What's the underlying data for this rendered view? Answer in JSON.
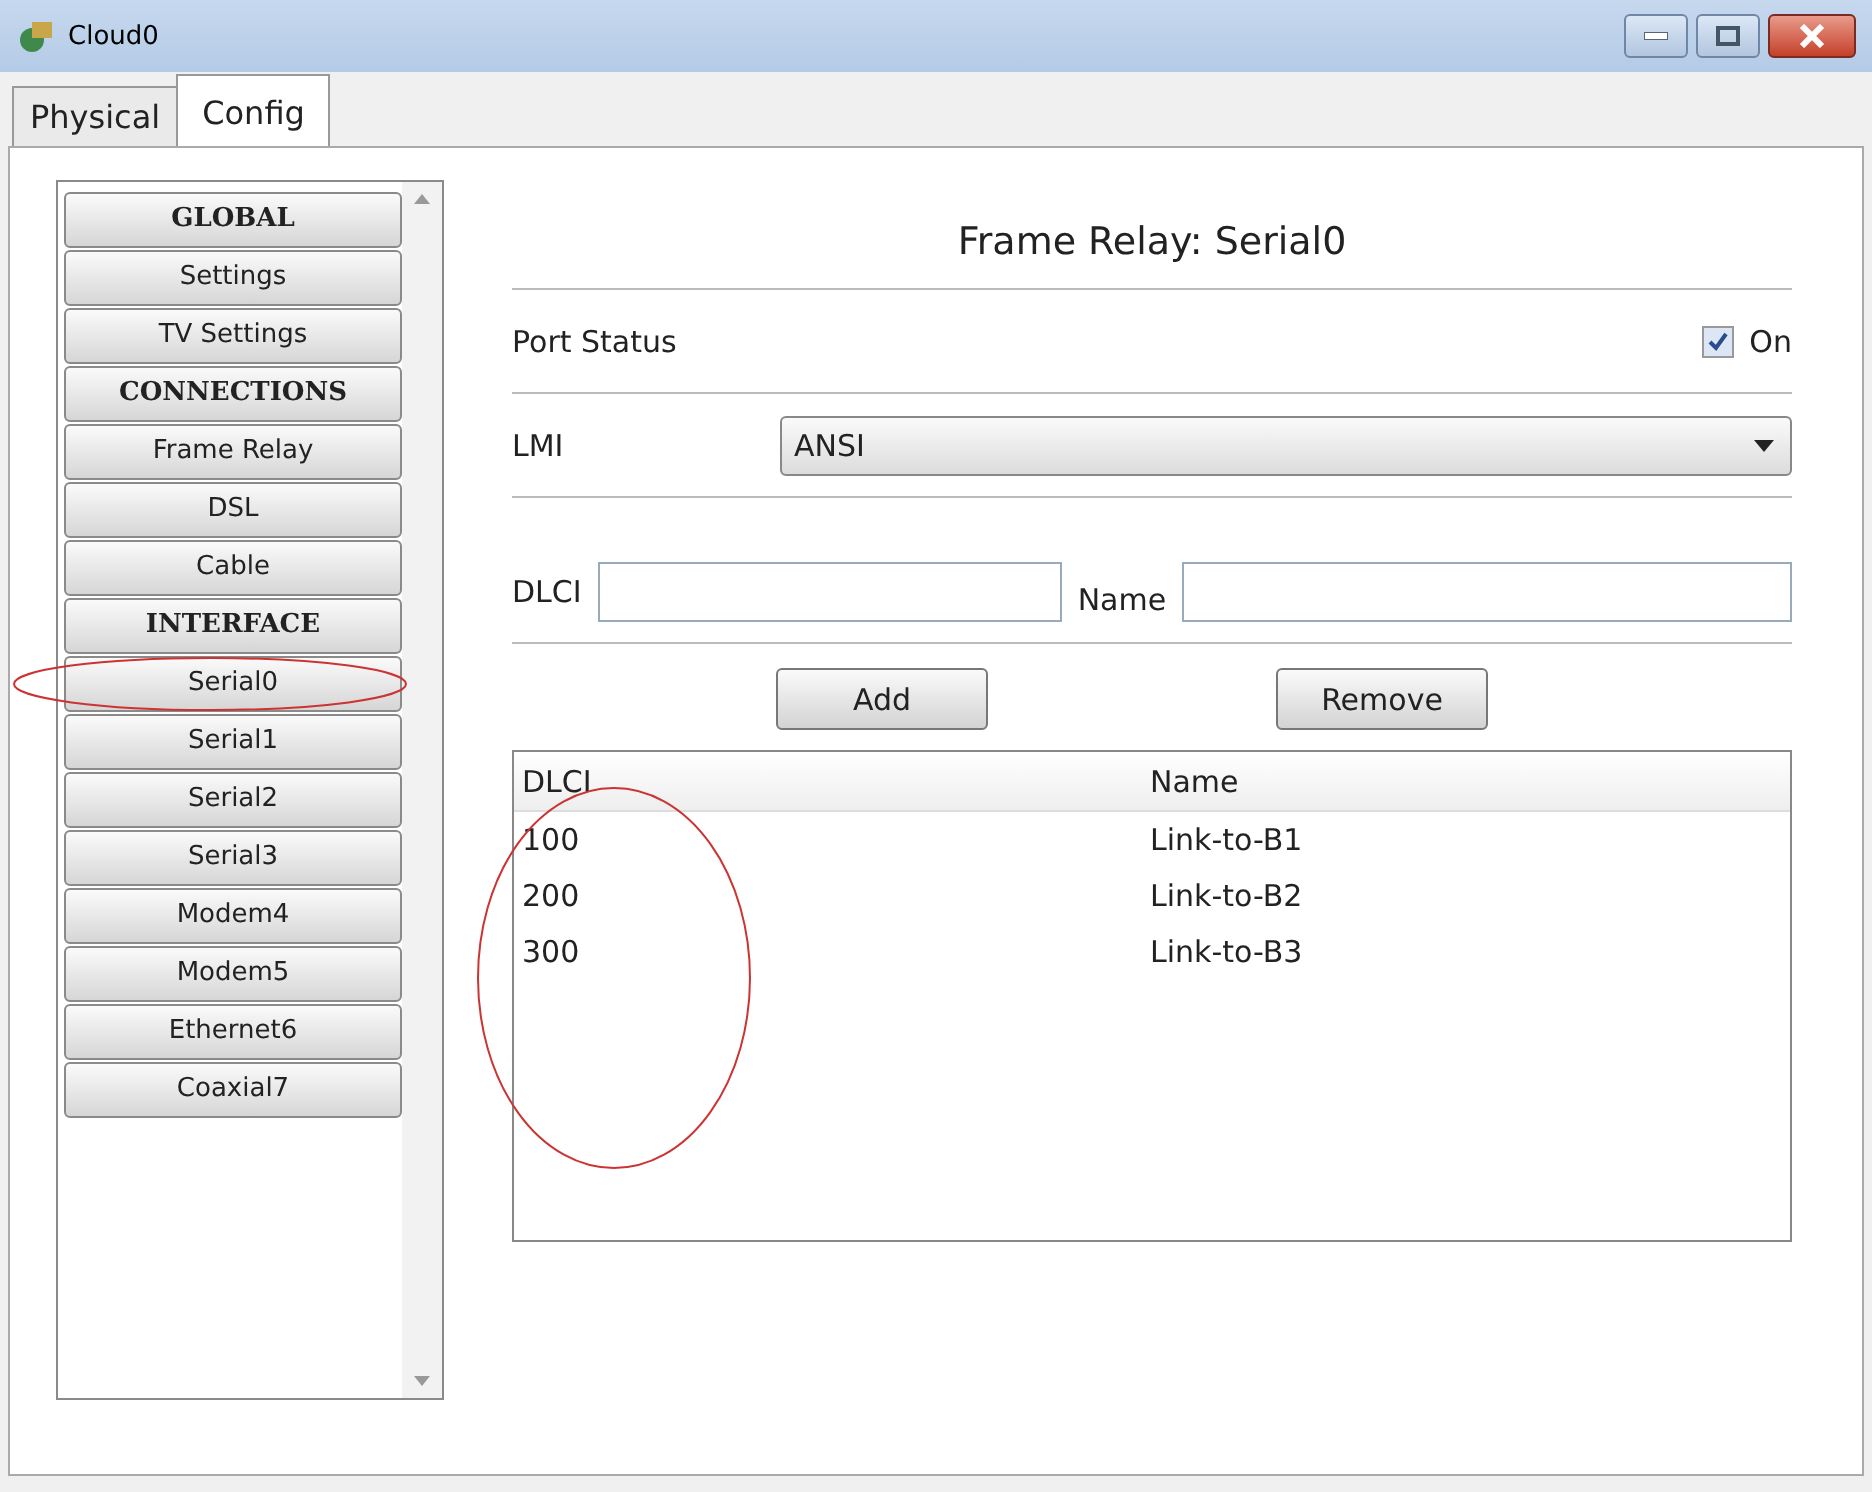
{
  "window": {
    "title": "Cloud0"
  },
  "tabs": [
    {
      "label": "Physical",
      "selected": false
    },
    {
      "label": "Config",
      "selected": true
    }
  ],
  "sidebar": {
    "items": [
      {
        "label": "GLOBAL",
        "kind": "header"
      },
      {
        "label": "Settings",
        "kind": "item"
      },
      {
        "label": "TV Settings",
        "kind": "item"
      },
      {
        "label": "CONNECTIONS",
        "kind": "header"
      },
      {
        "label": "Frame Relay",
        "kind": "item"
      },
      {
        "label": "DSL",
        "kind": "item"
      },
      {
        "label": "Cable",
        "kind": "item"
      },
      {
        "label": "INTERFACE",
        "kind": "header"
      },
      {
        "label": "Serial0",
        "kind": "item",
        "circled": true
      },
      {
        "label": "Serial1",
        "kind": "item"
      },
      {
        "label": "Serial2",
        "kind": "item"
      },
      {
        "label": "Serial3",
        "kind": "item"
      },
      {
        "label": "Modem4",
        "kind": "item"
      },
      {
        "label": "Modem5",
        "kind": "item"
      },
      {
        "label": "Ethernet6",
        "kind": "item"
      },
      {
        "label": "Coaxial7",
        "kind": "item"
      }
    ]
  },
  "panel": {
    "title": "Frame Relay: Serial0",
    "port_status": {
      "label": "Port Status",
      "checkbox_label": "On",
      "checked": true
    },
    "lmi": {
      "label": "LMI",
      "value": "ANSI"
    },
    "dlci_field": {
      "label": "DLCI"
    },
    "name_field": {
      "label": "Name"
    },
    "buttons": [
      "Add",
      "Remove"
    ],
    "table": {
      "columns": [
        {
          "label": "DLCI",
          "circled": true
        },
        {
          "label": "Name",
          "circled": false
        }
      ],
      "rows": [
        [
          "100",
          "Link-to-B1"
        ],
        [
          "200",
          "Link-to-B2"
        ],
        [
          "300",
          "Link-to-B3"
        ]
      ]
    }
  }
}
